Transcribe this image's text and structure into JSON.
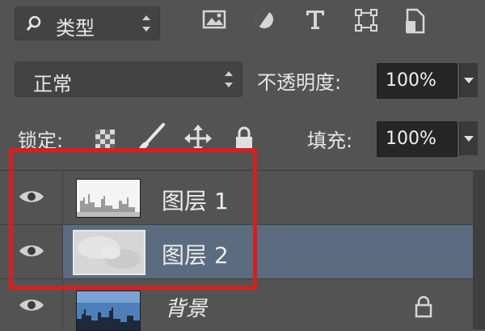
{
  "filter": {
    "kind_label": "类型",
    "icons": [
      "image-filter-icon",
      "adjustment-filter-icon",
      "type-filter-icon",
      "shape-filter-icon",
      "smart-object-filter-icon"
    ]
  },
  "blend": {
    "mode": "正常",
    "opacity_label": "不透明度:",
    "opacity_value": "100%"
  },
  "lock": {
    "label": "锁定:",
    "fill_label": "填充:",
    "fill_value": "100%"
  },
  "layers": [
    {
      "name": "图层 1",
      "selected": false
    },
    {
      "name": "图层 2",
      "selected": true
    },
    {
      "name": "背景",
      "selected": false,
      "locked": true
    }
  ],
  "colors": {
    "panel": "#535353",
    "selected_row": "#5b6b80",
    "highlight_box": "#d81e1e"
  }
}
